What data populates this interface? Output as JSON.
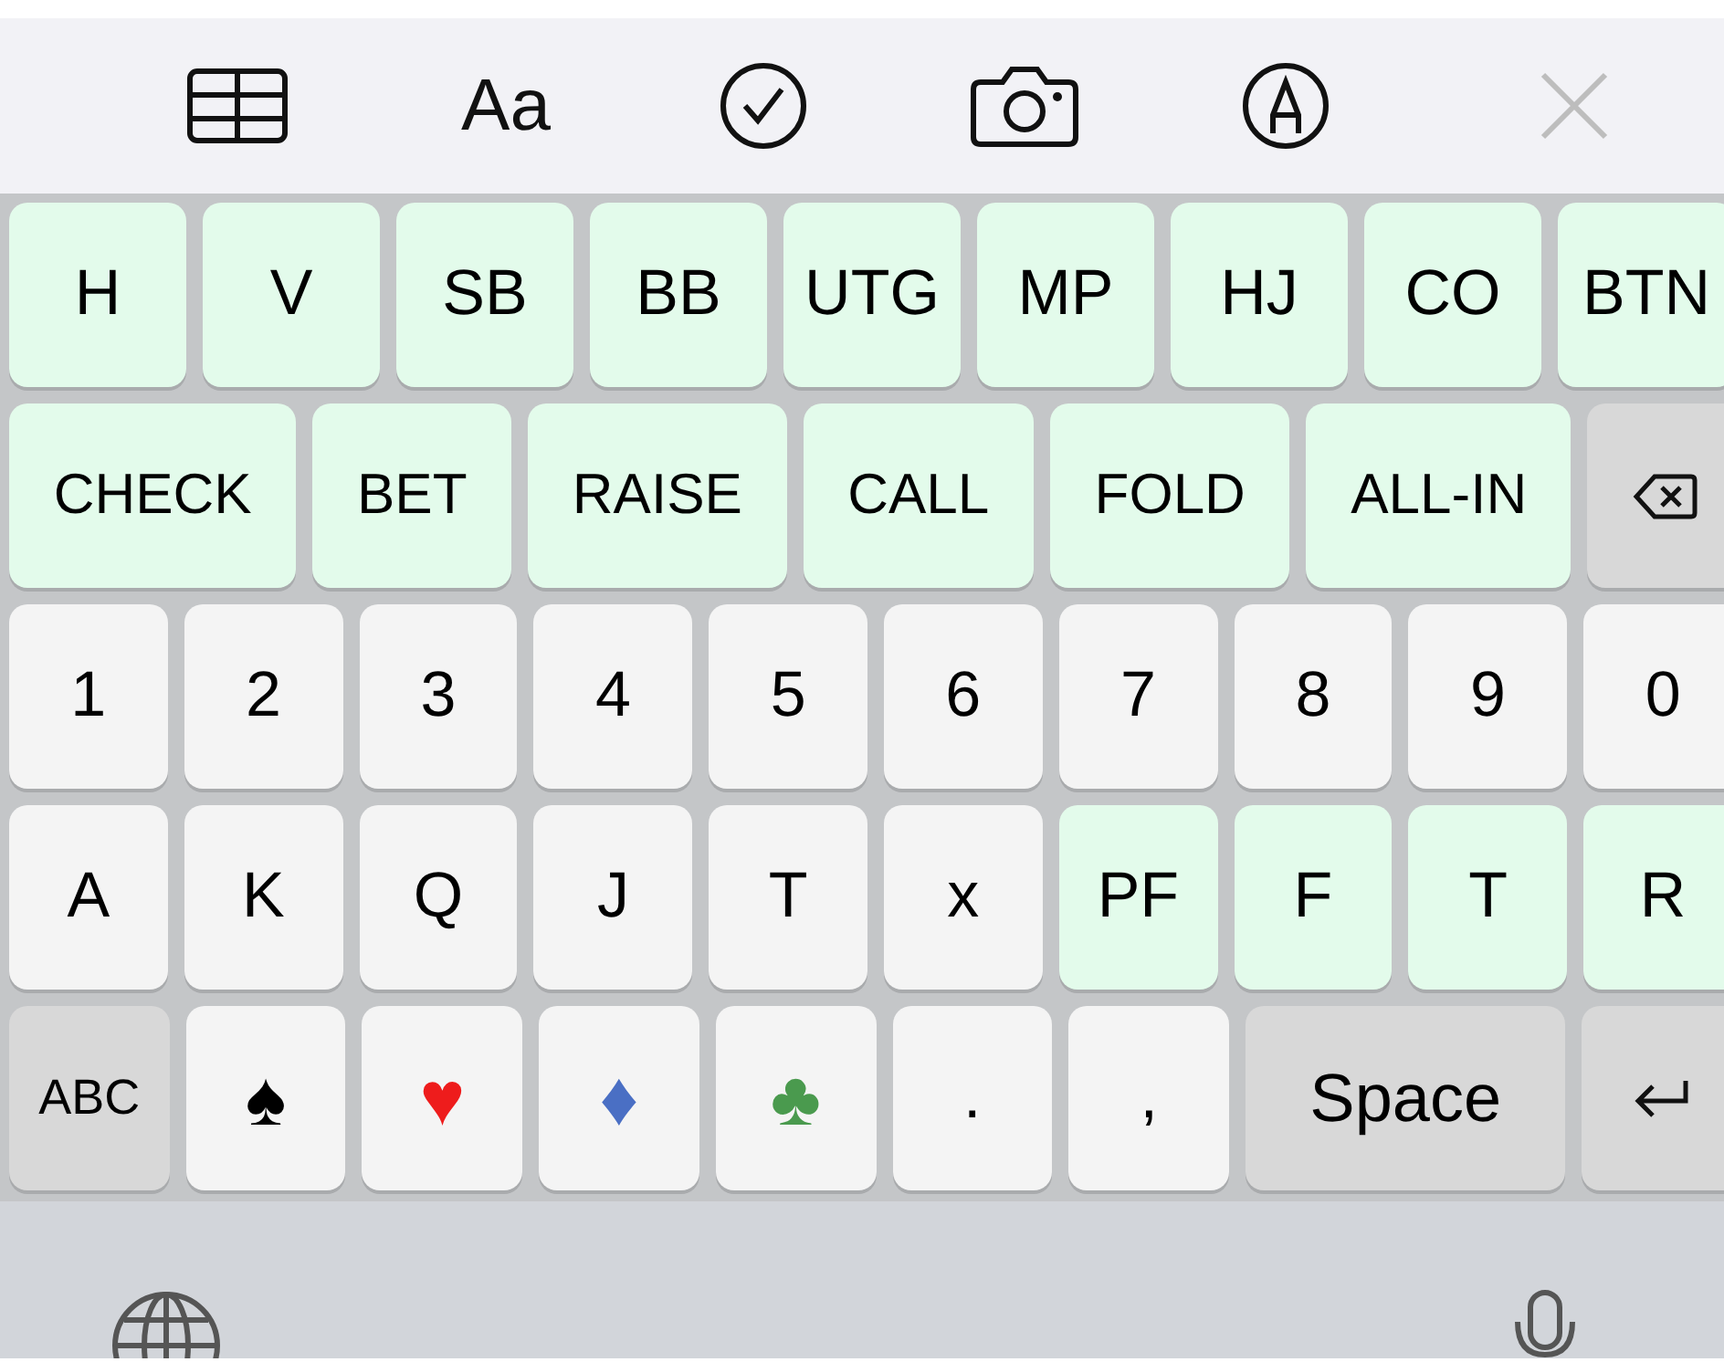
{
  "toolbar": [
    {
      "kind": "table"
    },
    {
      "kind": "text",
      "label": "Aa"
    },
    {
      "kind": "check"
    },
    {
      "kind": "camera"
    },
    {
      "kind": "markup"
    },
    {
      "kind": "close"
    }
  ],
  "rows": [
    [
      {
        "kind": "accent",
        "label": "H"
      },
      {
        "kind": "accent",
        "label": "V"
      },
      {
        "kind": "accent",
        "label": "SB"
      },
      {
        "kind": "accent",
        "label": "BB"
      },
      {
        "kind": "accent",
        "label": "UTG"
      },
      {
        "kind": "accent",
        "label": "MP"
      },
      {
        "kind": "accent",
        "label": "HJ"
      },
      {
        "kind": "accent",
        "label": "CO"
      },
      {
        "kind": "accent",
        "label": "BTN"
      }
    ],
    [
      {
        "kind": "accent",
        "label": "CHECK"
      },
      {
        "kind": "accent",
        "label": "BET"
      },
      {
        "kind": "accent",
        "label": "RAISE"
      },
      {
        "kind": "accent",
        "label": "CALL"
      },
      {
        "kind": "accent",
        "label": "FOLD"
      },
      {
        "kind": "accent",
        "label": "ALL-IN"
      },
      {
        "kind": "backspace"
      }
    ],
    [
      {
        "kind": "plain",
        "label": "1"
      },
      {
        "kind": "plain",
        "label": "2"
      },
      {
        "kind": "plain",
        "label": "3"
      },
      {
        "kind": "plain",
        "label": "4"
      },
      {
        "kind": "plain",
        "label": "5"
      },
      {
        "kind": "plain",
        "label": "6"
      },
      {
        "kind": "plain",
        "label": "7"
      },
      {
        "kind": "plain",
        "label": "8"
      },
      {
        "kind": "plain",
        "label": "9"
      },
      {
        "kind": "plain",
        "label": "0"
      }
    ],
    [
      {
        "kind": "plain",
        "label": "A"
      },
      {
        "kind": "plain",
        "label": "K"
      },
      {
        "kind": "plain",
        "label": "Q"
      },
      {
        "kind": "plain",
        "label": "J"
      },
      {
        "kind": "plain",
        "label": "T"
      },
      {
        "kind": "plain",
        "label": "x"
      },
      {
        "kind": "accent",
        "label": "PF"
      },
      {
        "kind": "accent",
        "label": "F"
      },
      {
        "kind": "accent",
        "label": "T"
      },
      {
        "kind": "accent",
        "label": "R"
      }
    ],
    [
      {
        "kind": "function",
        "label": "ABC"
      },
      {
        "kind": "suit",
        "label": "♠",
        "color": "#000000"
      },
      {
        "kind": "suit",
        "label": "♥",
        "color": "#ee1c1c"
      },
      {
        "kind": "suit",
        "label": "♦",
        "color": "#4a6fc4"
      },
      {
        "kind": "suit",
        "label": "♣",
        "color": "#4a9a4e"
      },
      {
        "kind": "plain",
        "label": "."
      },
      {
        "kind": "plain",
        "label": ","
      },
      {
        "kind": "space",
        "label": "Space"
      },
      {
        "kind": "return"
      }
    ]
  ],
  "bottom": [
    {
      "kind": "globe"
    },
    {
      "kind": "microphone"
    }
  ]
}
